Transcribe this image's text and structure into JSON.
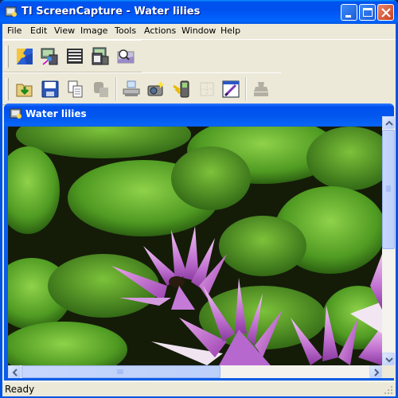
{
  "window": {
    "title": "TI ScreenCapture - Water lilies",
    "app_icon": "screencapture-app-icon",
    "caption_buttons": [
      "minimize",
      "maximize",
      "close"
    ]
  },
  "menu": {
    "items": [
      {
        "label": "File"
      },
      {
        "label": "Edit"
      },
      {
        "label": "View"
      },
      {
        "label": "Image"
      },
      {
        "label": "Tools"
      },
      {
        "label": "Actions"
      },
      {
        "label": "Window"
      },
      {
        "label": "Help"
      }
    ]
  },
  "toolbar1": {
    "buttons": [
      {
        "icon": "tile-icon",
        "enabled": true
      },
      {
        "icon": "capture-screen-icon",
        "enabled": true
      },
      {
        "icon": "capture-table-icon",
        "enabled": true
      },
      {
        "icon": "capture-device-icon",
        "enabled": true
      },
      {
        "icon": "zoom-view-icon",
        "enabled": true
      }
    ]
  },
  "toolbar2": {
    "buttons": [
      {
        "icon": "open-folder-icon",
        "enabled": true
      },
      {
        "icon": "save-icon",
        "enabled": true
      },
      {
        "icon": "copy-icon",
        "enabled": true
      },
      {
        "icon": "paste-icon",
        "enabled": false
      },
      {
        "icon": "print-icon",
        "enabled": true
      },
      {
        "icon": "camera-icon",
        "enabled": true
      },
      {
        "icon": "send-to-device-icon",
        "enabled": true
      },
      {
        "icon": "grid-icon",
        "enabled": false
      },
      {
        "icon": "edit-image-icon",
        "enabled": true
      },
      {
        "icon": "stamp-icon",
        "enabled": false
      }
    ]
  },
  "document": {
    "title": "Water lilies",
    "image_description": "Water lilies photo: green lily pads with pink/purple water lily flowers"
  },
  "scroll": {
    "vertical_position_fraction": 0.0,
    "horizontal_position_fraction": 0.0
  },
  "status": {
    "text": "Ready"
  }
}
